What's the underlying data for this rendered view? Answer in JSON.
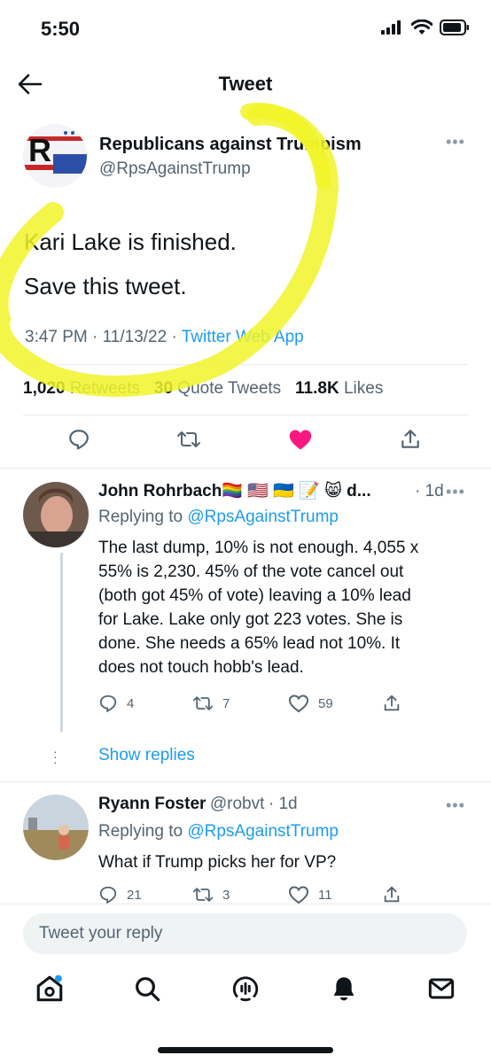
{
  "status_bar": {
    "time": "5:50"
  },
  "header": {
    "title": "Tweet"
  },
  "main_tweet": {
    "author_name": "Republicans against Trumpism",
    "author_handle": "@RpsAgainstTrump",
    "text_line1": "Kari Lake is finished.",
    "text_line2": "Save this tweet.",
    "time": "3:47 PM · 11/13/22 · ",
    "source": "Twitter Web App",
    "retweets_count": "1,020",
    "retweets_label": "Retweets",
    "quotes_count": "30",
    "quotes_label": "Quote Tweets",
    "likes_count": "11.8K",
    "likes_label": "Likes",
    "liked": true
  },
  "replies": [
    {
      "author_name": "John Rohrbach",
      "author_suffix": "🏳️‍🌈 🇺🇸 🇺🇦 📝 😸 d...",
      "age": "· 1d",
      "replying_prefix": "Replying to ",
      "replying_handle": "@RpsAgainstTrump",
      "lines": [
        "The last dump,  10% is not enough. 4,055 x",
        "55% is 2,230. 45% of the vote  cancel out",
        "(both got 45% of vote) leaving a 10% lead",
        "for Lake. Lake only got 223 votes. She is",
        "done.  She needs a 65% lead not 10%. It",
        "does not touch hobb's lead."
      ],
      "replies": "4",
      "retweets": "7",
      "likes": "59",
      "show_replies": "Show replies"
    },
    {
      "author_name": "Ryann Foster",
      "author_handle": "@robvt",
      "age": "· 1d",
      "replying_prefix": "Replying to ",
      "replying_handle": "@RpsAgainstTrump",
      "lines": [
        "What if Trump picks her for VP?"
      ],
      "replies": "21",
      "retweets": "3",
      "likes": "11"
    }
  ],
  "composer": {
    "placeholder": "Tweet your reply"
  },
  "bottom_nav": [
    "home-icon",
    "search-icon",
    "spaces-icon",
    "notifications-icon",
    "messages-icon"
  ],
  "colors": {
    "accent": "#1d9bf0",
    "like": "#f91880",
    "highlight": "#f1f528"
  }
}
